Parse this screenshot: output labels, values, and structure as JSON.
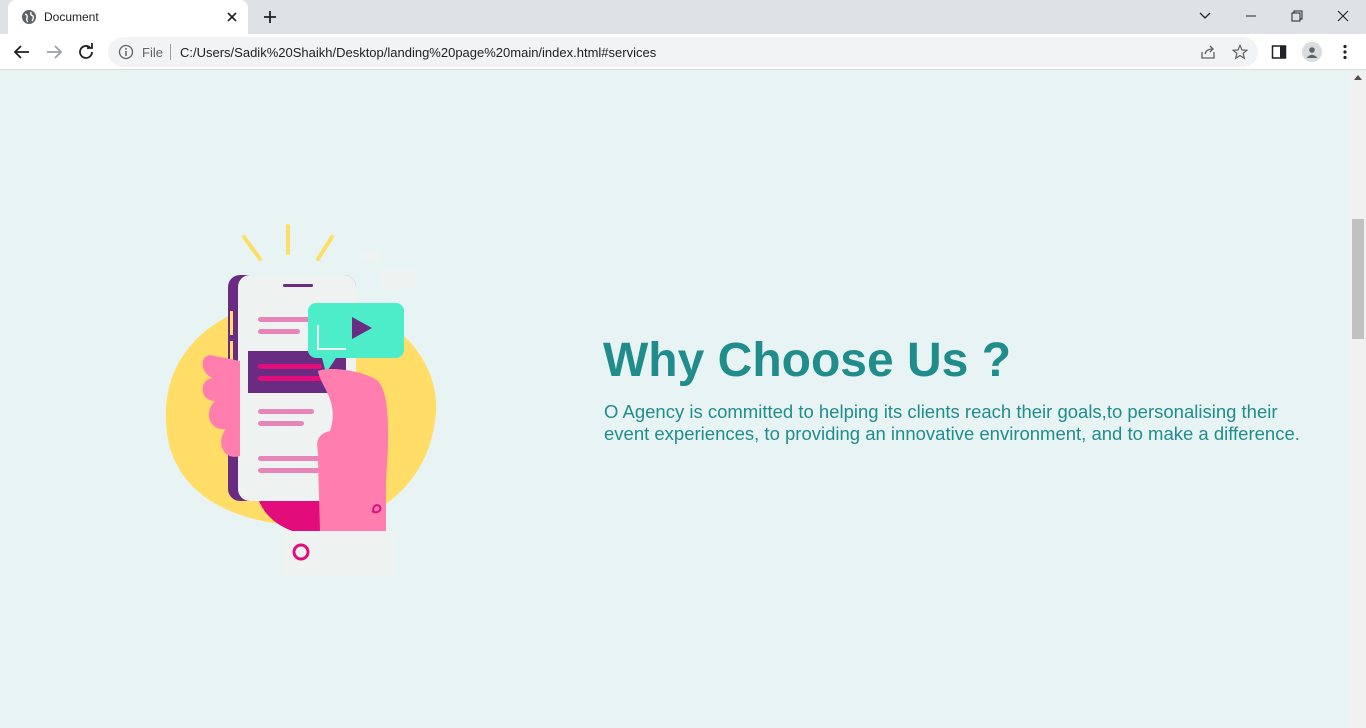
{
  "browser": {
    "tab_title": "Document",
    "address_scheme": "File",
    "url": "C:/Users/Sadik%20Shaikh/Desktop/landing%20page%20main/index.html#services"
  },
  "section": {
    "heading": "Why Choose Us ?",
    "paragraph": "O Agency is committed to helping its clients reach their goals,to personalising their event experiences, to providing an innovative environment, and to make a difference."
  },
  "colors": {
    "page_background": "#e8f4f3",
    "accent_text": "#218c8c",
    "blob": "#ffdd67",
    "hand": "#ff7eae",
    "phone_frame": "#6a2c83",
    "video_bubble": "#4dedc9"
  },
  "icons": [
    "globe-icon",
    "close-icon",
    "plus-icon",
    "chevron-down-icon",
    "minimize-icon",
    "restore-icon",
    "back-arrow-icon",
    "forward-arrow-icon",
    "reload-icon",
    "info-icon",
    "share-icon",
    "star-icon",
    "side-panel-icon",
    "profile-icon",
    "kebab-menu-icon"
  ]
}
